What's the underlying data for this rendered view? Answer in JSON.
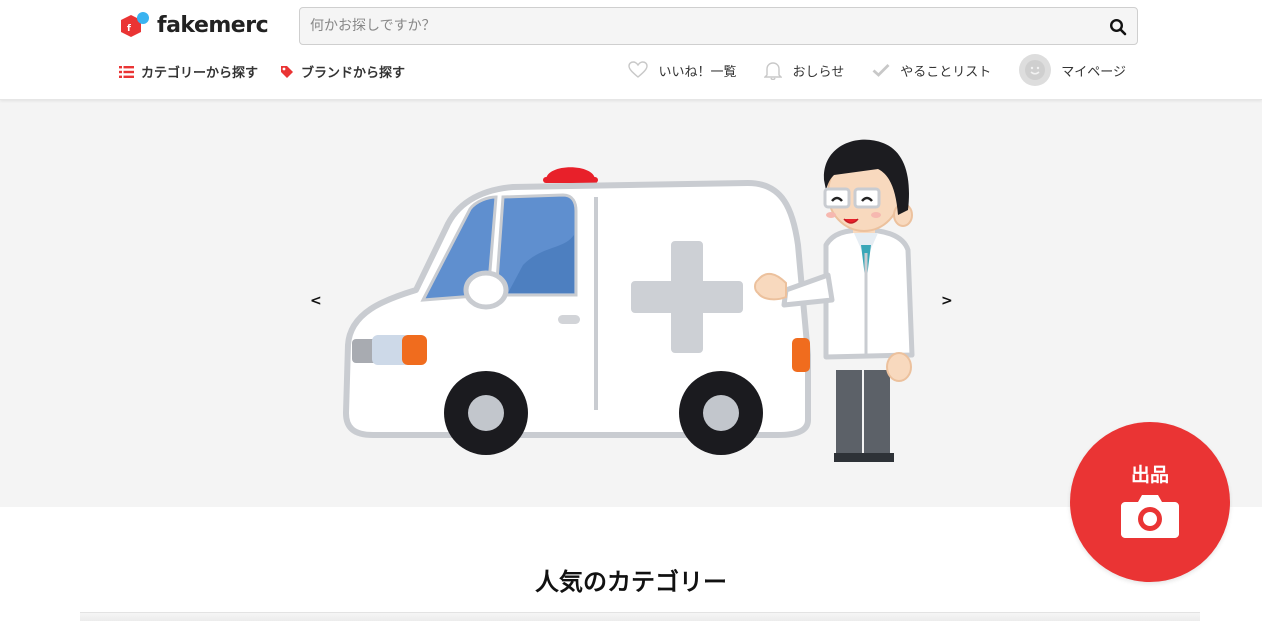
{
  "header": {
    "brand": "fakemerc",
    "search": {
      "placeholder": "何かお探しですか？"
    },
    "nav_left": [
      {
        "label": "カテゴリーから探す",
        "icon": "list-icon"
      },
      {
        "label": "ブランドから探す",
        "icon": "tag-icon"
      }
    ],
    "nav_right": [
      {
        "label": "いいね！一覧",
        "icon": "heart-icon"
      },
      {
        "label": "おしらせ",
        "icon": "bell-icon"
      },
      {
        "label": "やることリスト",
        "icon": "check-icon"
      },
      {
        "label": "マイページ",
        "icon": "avatar"
      }
    ]
  },
  "carousel": {
    "prev": "<",
    "next": ">"
  },
  "section": {
    "title": "人気のカテゴリー"
  },
  "sell_button": {
    "label": "出品",
    "icon": "camera-icon"
  },
  "colors": {
    "brand_red": "#ea3434",
    "brand_blue": "#3ab3f0",
    "banner_bg": "#f4f4f4"
  }
}
